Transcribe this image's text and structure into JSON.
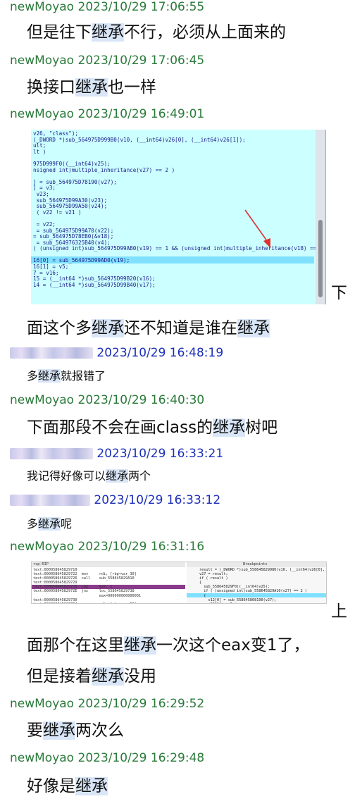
{
  "messages": [
    {
      "name": "newMoyao",
      "time": "2023/10/29 17:06:55",
      "text_pre": "但是往下",
      "text_hl": "继承",
      "text_post": "不行，必须从上面来的"
    },
    {
      "name": "newMoyao",
      "time": "2023/10/29 17:06:45",
      "text_pre": "换接口",
      "text_hl": "继承",
      "text_post": "也一样"
    },
    {
      "name": "newMoyao",
      "time": "2023/10/29 16:49:01",
      "shot_caption_tail": "下",
      "line2_pre": "面这个多",
      "line2_hl": "继承",
      "line2_mid": "还不知道是谁在",
      "line2_hl2": "继承"
    },
    {
      "name": "",
      "time": "2023/10/29 16:48:19",
      "text_pre": "多",
      "text_hl": "继承",
      "text_post": "就报错了"
    },
    {
      "name": "newMoyao",
      "time": "2023/10/29 16:40:30",
      "text_pre": "下面那段不会在画class的",
      "text_hl": "继承",
      "text_post": "树吧"
    },
    {
      "name": "",
      "time": "2023/10/29 16:33:21",
      "text_pre": "我记得好像可以",
      "text_hl": "继承",
      "text_post": "两个"
    },
    {
      "name": "",
      "time": "2023/10/29 16:33:12",
      "text_pre": "多",
      "text_hl": "继承",
      "text_post": "呢"
    },
    {
      "name": "newMoyao",
      "time": "2023/10/29 16:31:16",
      "shot_caption_tail": "上",
      "line2_pre": "面那个在这里",
      "line2_hl": "继承",
      "line2_post": "一次这个eax变1了，",
      "line3_pre": "但是接着",
      "line3_hl": "继承",
      "line3_post": "没用"
    },
    {
      "name": "newMoyao",
      "time": "2023/10/29 16:29:52",
      "text_pre": "要",
      "text_hl": "继承",
      "text_post": "两次么"
    },
    {
      "name": "newMoyao",
      "time": "2023/10/29 16:29:48",
      "text_pre": "好像是",
      "text_hl": "继承",
      "text_post": ""
    }
  ],
  "shot1": {
    "code": "v26, \"class\");\n(_DWORD *)sub_564975D999B0(v10, (__int64)v26[0], (__int64)v26[1]);\nult;\nlt )\n\n975D999F0((__int64)v25);\nnsigned int)multiple_inheritance(v27) == 2 )\n\n] = sub_564975D78190(v27);\n] = v3;\n v23;\n sub_564975D99A30(v23);\n sub_564975D99A50(v24);\n ( v22 != v21 )\n\n = v22;\n = sub_564975D99A70(v22);\n= sub_564975D78EB0(&v18);\n = sub_564976325B40(v4);\n( (unsigned int)sub_564975D99AB0(v19) == 1 && (unsigned int)multiple_inheritance(v18) ==\n\n16[0] = sub_564975D99AD0(v19);\n16[1] = v5;\n7 = v16;\n15 = (__int64 *)sub_564975D99B20(v16);\n14 = (__int64 *)sub_564975D99B40(v17);"
  },
  "shot2": {
    "left_title": "rsp-RIP",
    "right_title": "Breakpoints",
    "left_code": "text:000058645829710  \ntext:000058645829722  mov     rdi, [rbp+var_30]\ntext:000058645829726  call    sub_558645829A10\ntext:000058645829729\ntext:00005864582972B  cmp     eax, 1\ntext:00005864582972E  jnz     loc_558645829738\n                              eax=000000000000001\ntext:000058645829730\ntext:000058645829734  mov     rdi, [rbp+var_30]\ntext:000058645829738  call    sub_558645808190\ntext:000058645829738\ntext:00005864582973D  mov     [rbp+var_78], rax\ntext:000058645829741  mov     [rbp+var_40], rdx",
    "right_code": "result = (_DWORD *)sub_558645829980(v10, (__int64)v26[0],\nv27 = result;\nif ( result )\n{\n  sub_558645829F0((__int64)v25);\n  if ( (unsigned int)sub_558645829A10(v27) == 2 )\n  {\n    v12[0] = sub_558645808190(v27);\n    v12[1] = v3;\n    v24 = v23;\n    v22 = sub_558645829A30(v23);\n    v21 = sub_558645829A50(v24);"
  }
}
